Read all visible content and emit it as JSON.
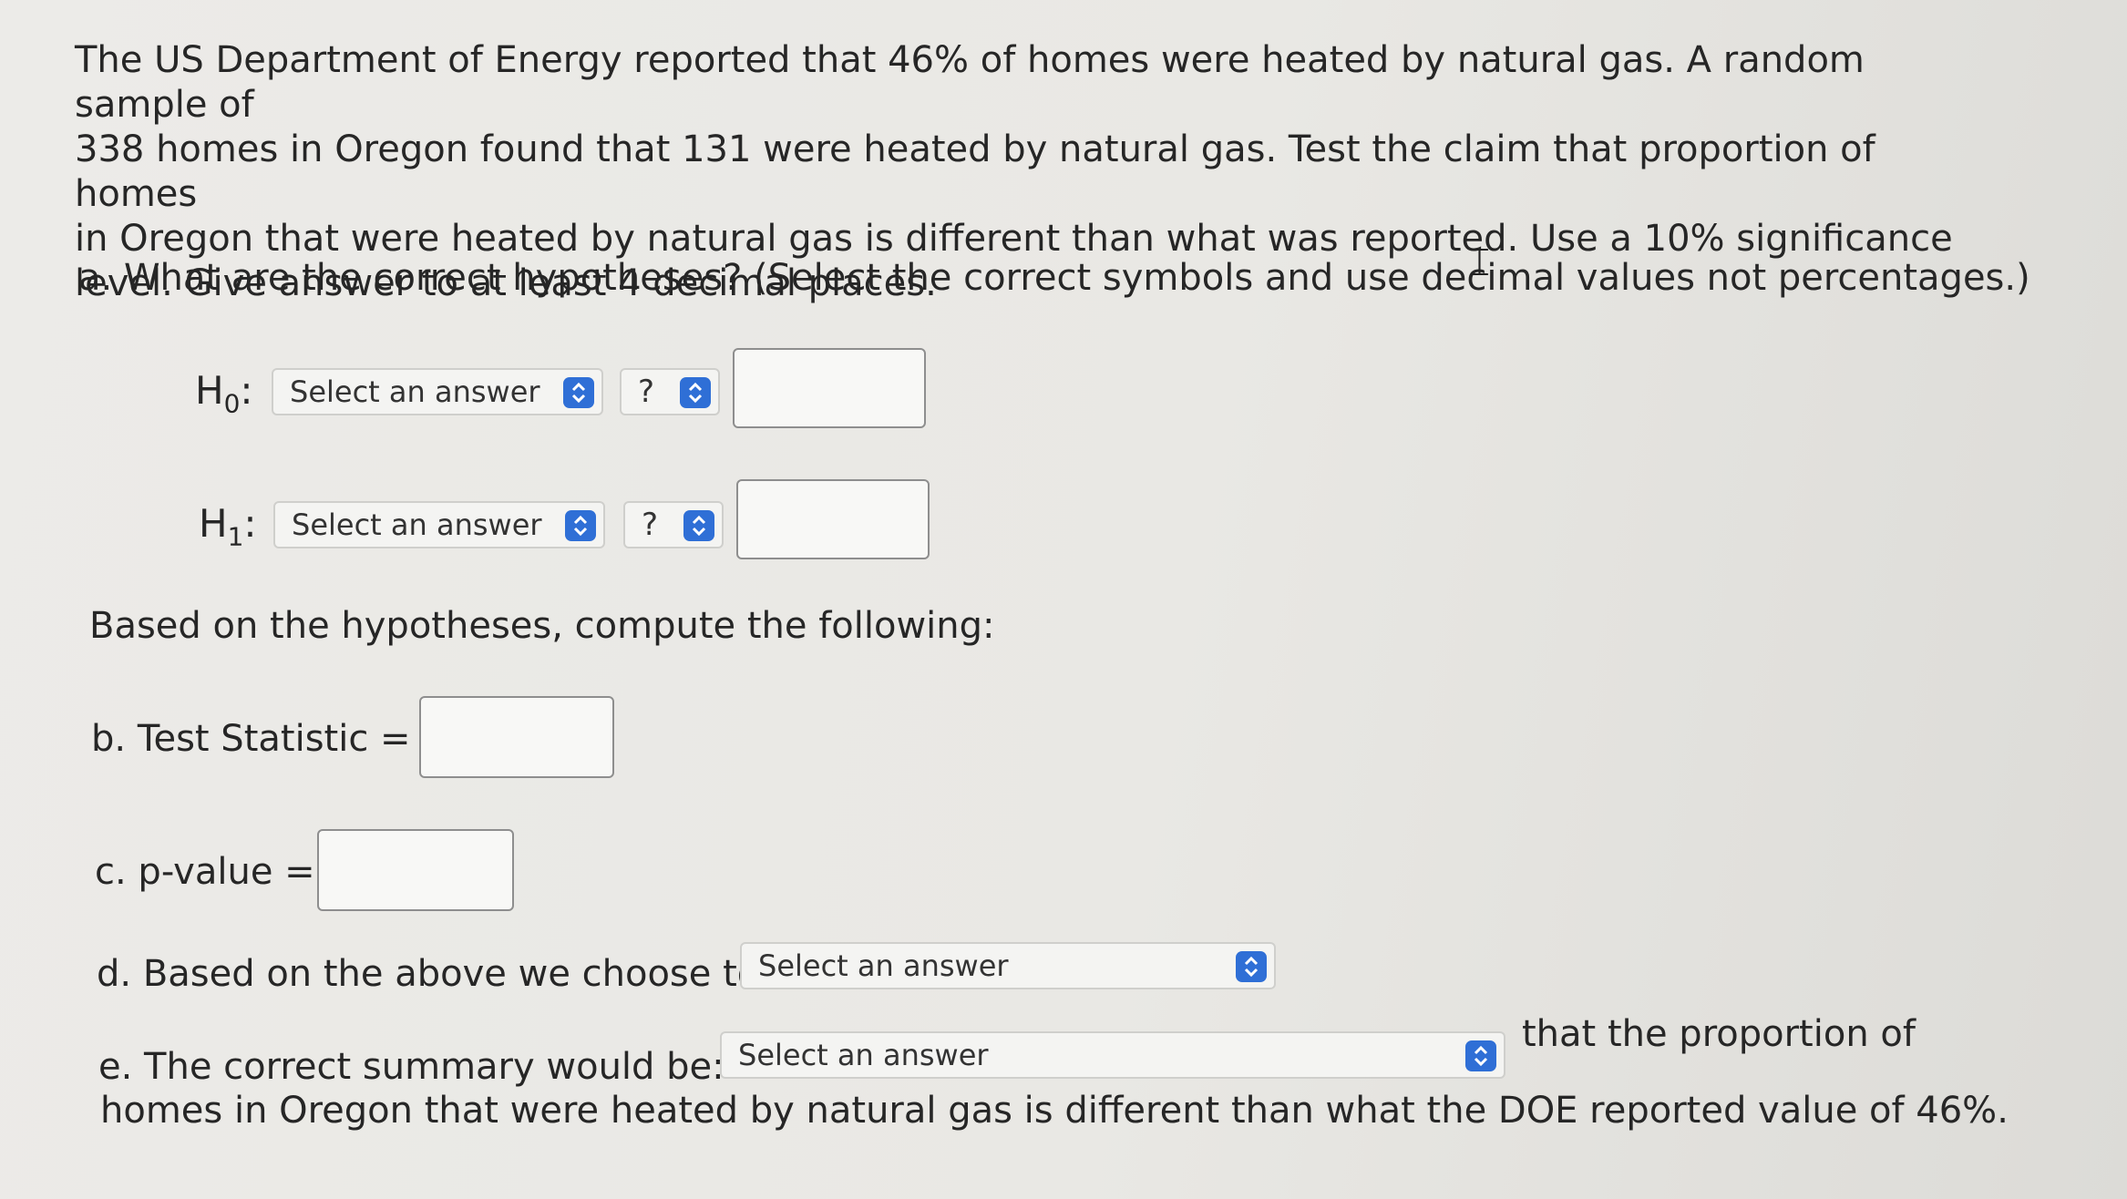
{
  "problem": {
    "line1": "The US Department of Energy reported that 46% of homes were heated by natural gas. A random sample of",
    "line2": "338 homes in Oregon found that 131 were heated by natural gas. Test the claim that proportion of homes",
    "line3": "in Oregon that were heated by natural gas is different than what was reported. Use a 10% significance",
    "line4": "level. Give answer to at least 4 decimal places."
  },
  "part_a": {
    "question": "a. What are the correct hypotheses? (Select the correct symbols and use decimal values not percentages.)",
    "h0": {
      "label": "H",
      "sub": "0",
      "colon": ":",
      "select_value": "Select an answer",
      "symbol_value": "?",
      "input_value": ""
    },
    "h1": {
      "label": "H",
      "sub": "1",
      "colon": ":",
      "select_value": "Select an answer",
      "symbol_value": "?",
      "input_value": ""
    }
  },
  "compute_heading": "Based on the hypotheses, compute the following:",
  "part_b": {
    "label": "b. Test Statistic =",
    "input_value": ""
  },
  "part_c": {
    "label": "c. p-value =",
    "input_value": ""
  },
  "part_d": {
    "label": "d. Based on the above we choose to",
    "select_value": "Select an answer"
  },
  "part_e": {
    "label": "e. The correct summary would be:",
    "select_value": "Select an answer",
    "tail1": "that the proportion of",
    "tail2": "homes in Oregon that were heated by natural gas is different than what the DOE reported value of 46%."
  },
  "colors": {
    "accent": "#2f6fd6",
    "text": "#262626",
    "background": "#eae9e6"
  },
  "icons": {
    "dropdown": "updown-chevron-icon",
    "cursor": "text-cursor-icon"
  }
}
